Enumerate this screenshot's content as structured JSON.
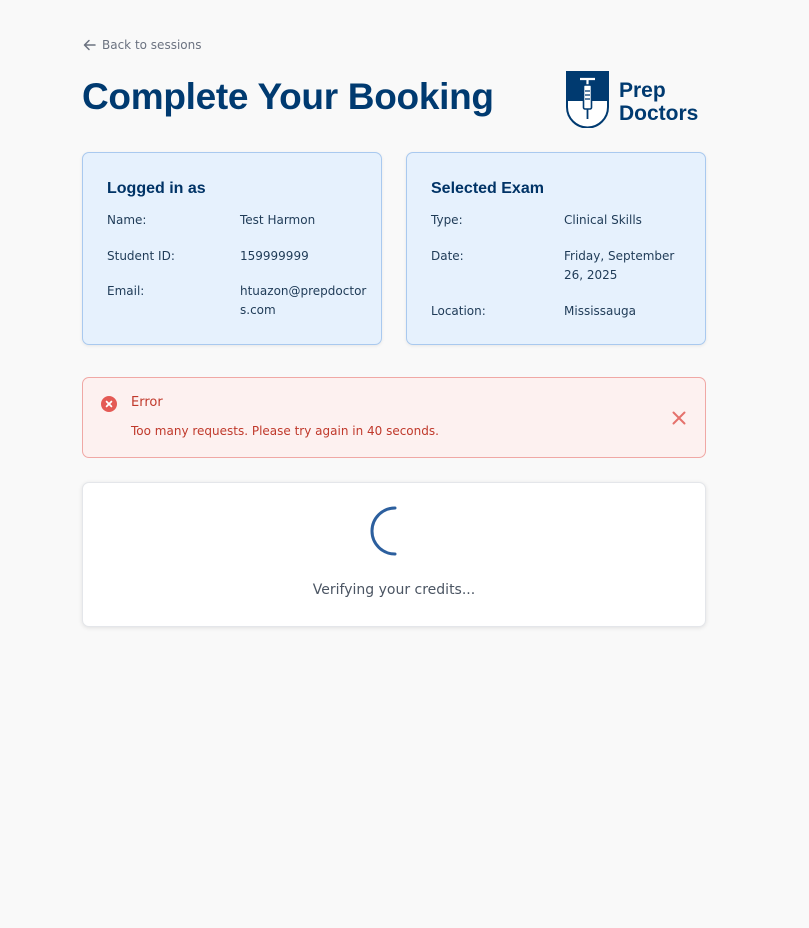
{
  "nav": {
    "back_label": "Back to sessions",
    "back_icon": "arrow-left-icon"
  },
  "header": {
    "title": "Complete Your Booking",
    "logo_line1": "Prep",
    "logo_line2": "Doctors",
    "brand_color": "#003a70"
  },
  "user_card": {
    "title": "Logged in as",
    "rows": [
      {
        "label": "Name:",
        "value": "Test Harmon"
      },
      {
        "label": "Student ID:",
        "value": "159999999"
      },
      {
        "label": "Email:",
        "value": "htuazon@prepdoctors.com"
      }
    ]
  },
  "exam_card": {
    "title": "Selected Exam",
    "rows": [
      {
        "label": "Type:",
        "value": "Clinical Skills"
      },
      {
        "label": "Date:",
        "value": "Friday, September 26, 2025"
      },
      {
        "label": "Location:",
        "value": "Mississauga"
      }
    ]
  },
  "error": {
    "title": "Error",
    "message": "Too many requests. Please try again in 40 seconds.",
    "icon": "error-x-circle-icon",
    "close_icon": "close-icon",
    "color": "#c0392b"
  },
  "loading": {
    "text": "Verifying your credits...",
    "icon": "spinner-icon"
  },
  "colors": {
    "card_bg": "#e6f1fd",
    "card_border": "#a9c9ef",
    "page_bg": "#f9f9f9"
  }
}
